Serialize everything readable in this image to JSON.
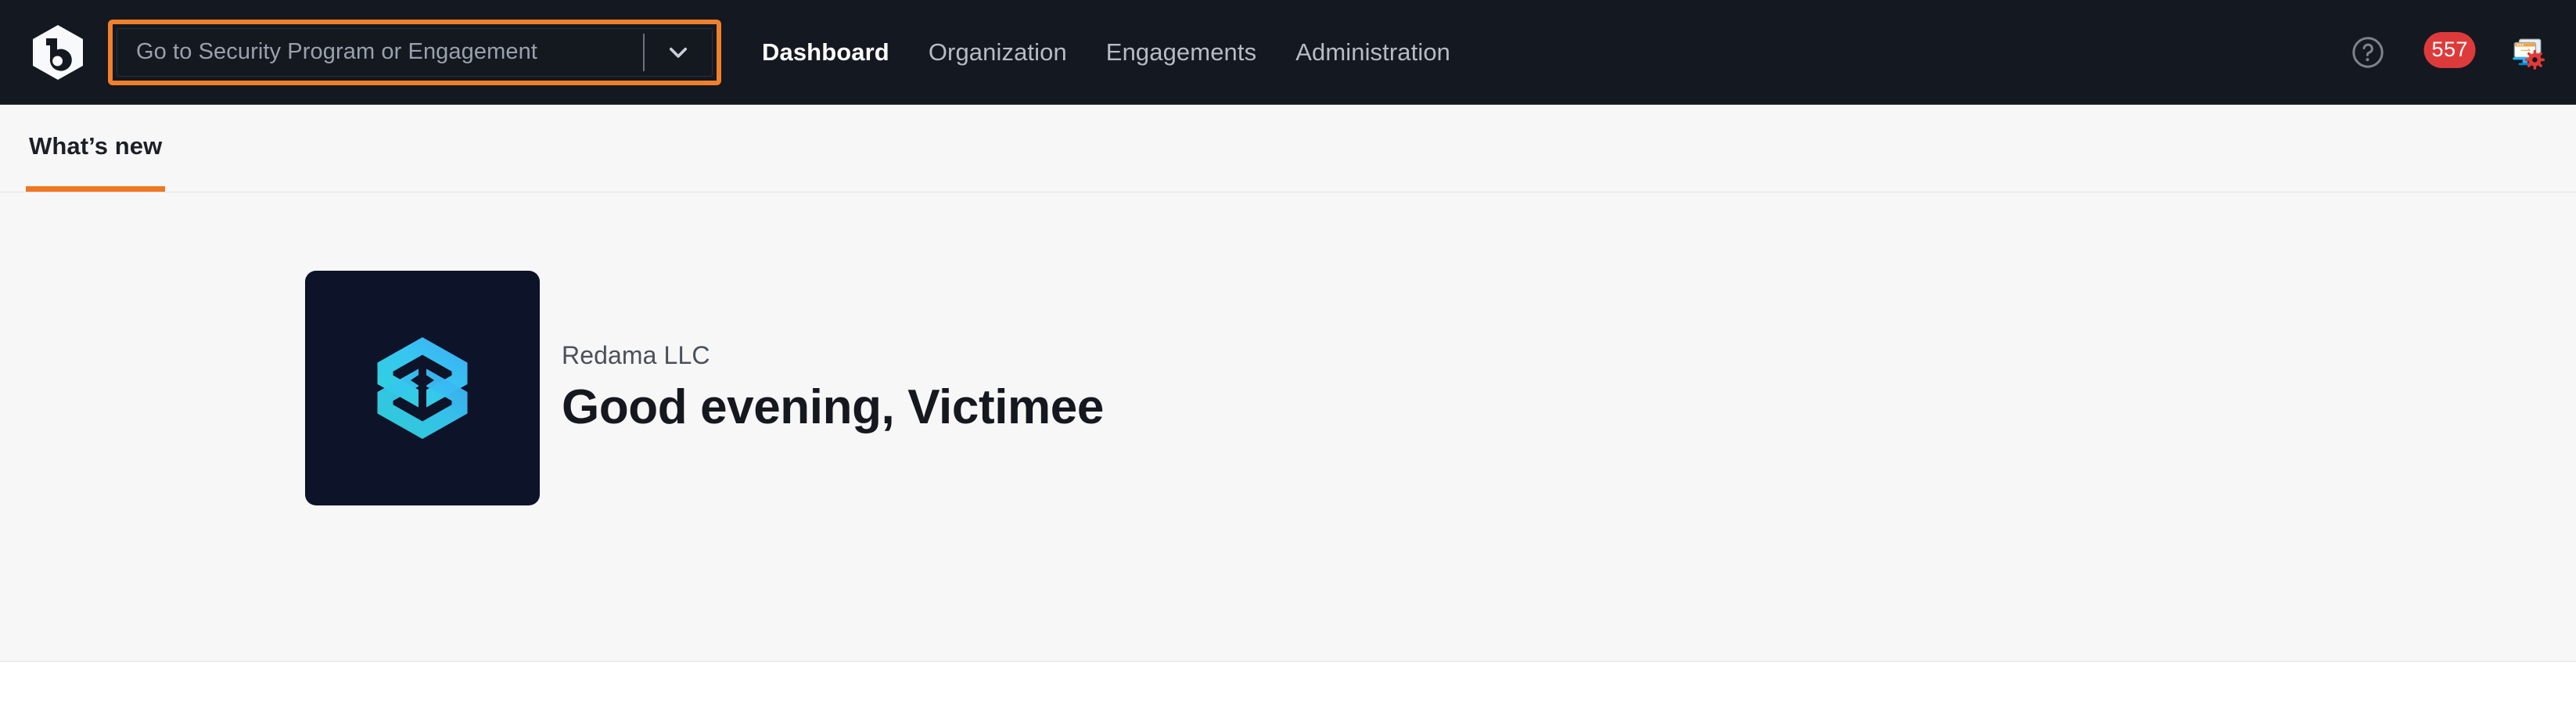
{
  "header": {
    "brand_icon": "bugcrowd-b-hexagon-logo",
    "program_selector": {
      "placeholder": "Go to Security Program or Engagement",
      "value": "",
      "caret_icon": "chevron-down-icon",
      "focus_ring_color": "#f0802b"
    },
    "nav": [
      {
        "label": "Dashboard",
        "active": true
      },
      {
        "label": "Organization",
        "active": false
      },
      {
        "label": "Engagements",
        "active": false
      },
      {
        "label": "Administration",
        "active": false
      }
    ],
    "utilities": [
      {
        "name": "help-icon",
        "icon": "question-circle-icon"
      },
      {
        "name": "notifications-icon",
        "icon": "bell-icon",
        "badge_count": "557",
        "badge_color": "#dd3b3b"
      },
      {
        "name": "admin-console-icon",
        "icon": "desktop-gear-icon"
      }
    ],
    "background_color": "#141821"
  },
  "tabs": [
    {
      "label": "What’s new",
      "active": true
    }
  ],
  "main": {
    "org_tile": {
      "icon": "cube-hexagon-logo",
      "background_color": "#0d1329",
      "accent_color": "#3fc9f0"
    },
    "org_name": "Redama LLC",
    "greeting": "Good evening, Victimee"
  }
}
